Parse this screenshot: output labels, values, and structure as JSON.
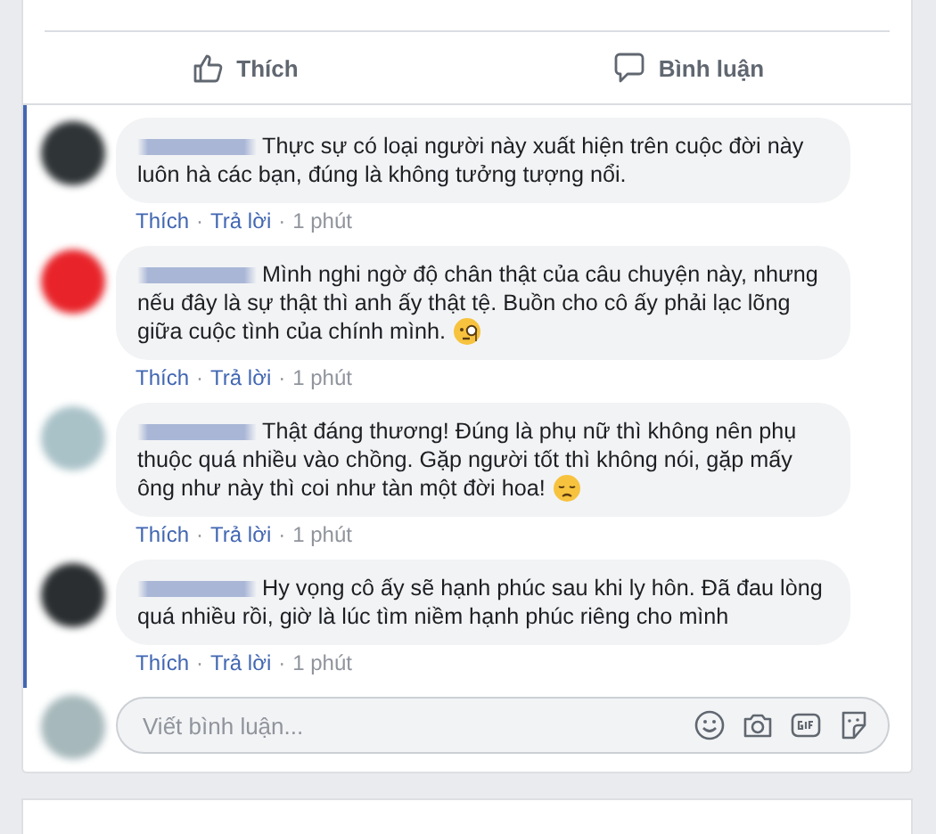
{
  "actions": [
    {
      "kind": "like",
      "label": "Thích"
    },
    {
      "kind": "comment",
      "label": "Bình luận"
    }
  ],
  "comments": [
    {
      "kind": "plain",
      "text": "Thực sự có loại người này xuất hiện trên cuộc đời này luôn hà các bạn, đúng là không tưởng tượng nổi.",
      "meta": [
        {
          "kind": "link",
          "text": "Thích"
        },
        {
          "kind": "separator",
          "text": "·"
        },
        {
          "kind": "link",
          "text": "Trả lời"
        },
        {
          "kind": "separator",
          "text": "·"
        },
        {
          "kind": "time",
          "text": "1 phút"
        }
      ]
    },
    {
      "kind": "monocle",
      "text": "Mình nghi ngờ độ chân thật của câu chuyện này, nhưng nếu đây là sự thật thì anh ấy thật tệ. Buồn cho cô ấy phải lạc lõng giữa cuộc tình của chính mình.",
      "meta": [
        {
          "kind": "link",
          "text": "Thích"
        },
        {
          "kind": "separator",
          "text": "·"
        },
        {
          "kind": "link",
          "text": "Trả lời"
        },
        {
          "kind": "separator",
          "text": "·"
        },
        {
          "kind": "time",
          "text": "1 phút"
        }
      ]
    },
    {
      "kind": "sad",
      "text": "Thật đáng thương! Đúng là phụ nữ thì không nên phụ thuộc quá nhiều vào chồng. Gặp người tốt thì không nói, gặp mấy ông như này thì coi như tàn một đời hoa!",
      "meta": [
        {
          "kind": "link",
          "text": "Thích"
        },
        {
          "kind": "separator",
          "text": "·"
        },
        {
          "kind": "link",
          "text": "Trả lời"
        },
        {
          "kind": "separator",
          "text": "·"
        },
        {
          "kind": "time",
          "text": "1 phút"
        }
      ]
    },
    {
      "kind": "plain",
      "text": "Hy vọng cô ấy sẽ hạnh phúc sau khi ly hôn. Đã đau lòng quá nhiều rồi, giờ là lúc tìm niềm hạnh phúc riêng cho mình",
      "meta": [
        {
          "kind": "link",
          "text": "Thích"
        },
        {
          "kind": "separator",
          "text": "·"
        },
        {
          "kind": "link",
          "text": "Trả lời"
        },
        {
          "kind": "separator",
          "text": "·"
        },
        {
          "kind": "time",
          "text": "1 phút"
        }
      ]
    }
  ],
  "composer": {
    "placeholder": "Viết bình luận..."
  }
}
